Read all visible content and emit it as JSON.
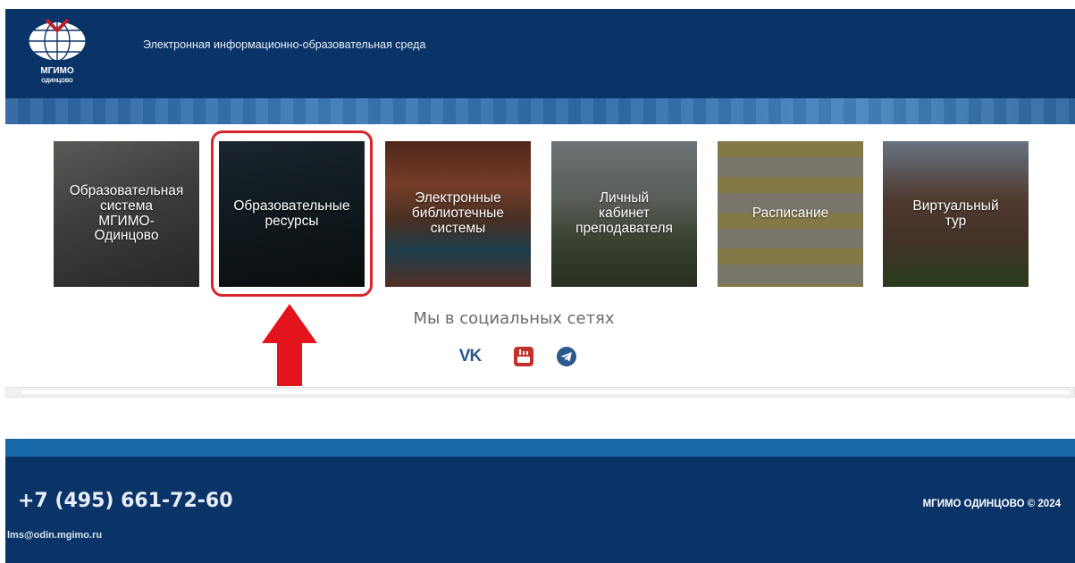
{
  "header": {
    "title": "Электронная информационно-образовательная среда",
    "logo_text_top": "МГИМО",
    "logo_text_bottom": "ОДИНЦОВО"
  },
  "tiles": [
    {
      "label": "Образовательная\nсистема\nМГИМО-\nОдинцово"
    },
    {
      "label": "Образовательные\nресурсы"
    },
    {
      "label": "Электронные\nбиблиотечные\nсистемы"
    },
    {
      "label": "Личный\nкабинет\nпреподавателя"
    },
    {
      "label": "Расписание"
    },
    {
      "label": "Виртуальный\nтур"
    }
  ],
  "social": {
    "title": "Мы в социальных сетях",
    "icons": [
      "vk-icon",
      "youtube-icon",
      "telegram-icon"
    ],
    "vk_text": "VK"
  },
  "footer": {
    "phone": "+7 (495) 661-72-60",
    "email": "lms@odin.mgimo.ru",
    "copyright": "МГИМО ОДИНЦОВО © 2024"
  },
  "colors": {
    "header_bg": "#0a3468",
    "footer_band": "#1768a8",
    "highlight": "#d8242c"
  }
}
